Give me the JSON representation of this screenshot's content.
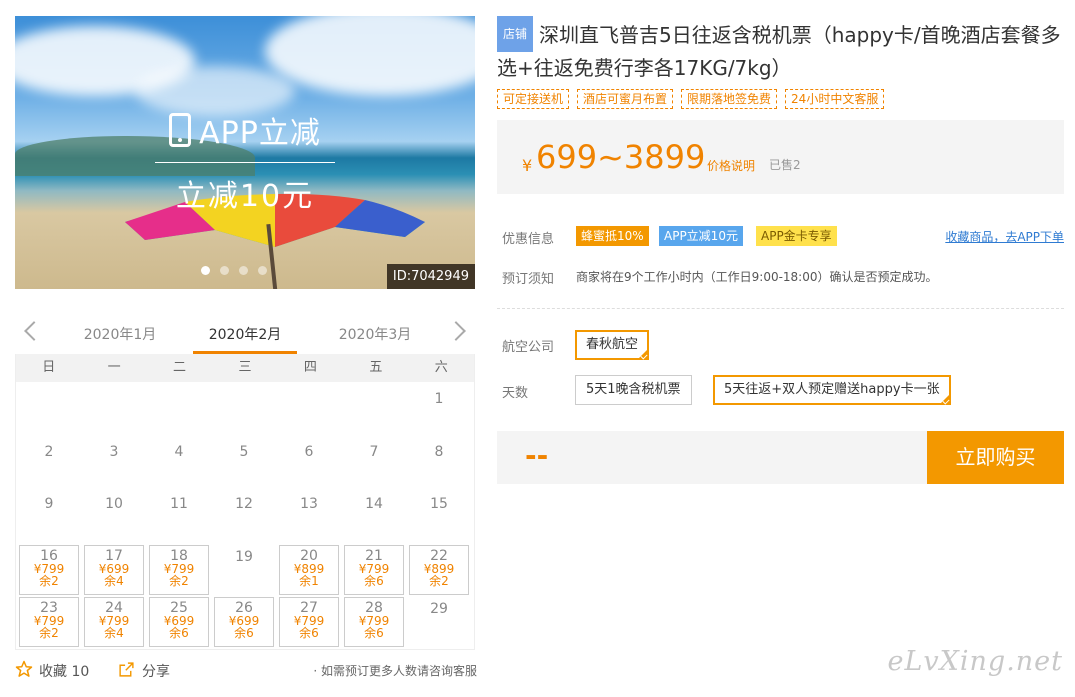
{
  "banner": {
    "app_text": "APP立减",
    "discount_text": "立减10元",
    "id_label": "ID:7042949"
  },
  "calendar": {
    "months": [
      "2020年1月",
      "2020年2月",
      "2020年3月"
    ],
    "weekdays": [
      "日",
      "一",
      "二",
      "三",
      "四",
      "五",
      "六"
    ],
    "days": [
      {
        "d": "1"
      },
      {
        "d": "2"
      },
      {
        "d": "3"
      },
      {
        "d": "4"
      },
      {
        "d": "5"
      },
      {
        "d": "6"
      },
      {
        "d": "7"
      },
      {
        "d": "8"
      },
      {
        "d": "9"
      },
      {
        "d": "10"
      },
      {
        "d": "11"
      },
      {
        "d": "12"
      },
      {
        "d": "13"
      },
      {
        "d": "14"
      },
      {
        "d": "15"
      },
      {
        "d": "16",
        "price": "¥799",
        "left": "余2"
      },
      {
        "d": "17",
        "price": "¥699",
        "left": "余4"
      },
      {
        "d": "18",
        "price": "¥799",
        "left": "余2"
      },
      {
        "d": "19"
      },
      {
        "d": "20",
        "price": "¥899",
        "left": "余1"
      },
      {
        "d": "21",
        "price": "¥799",
        "left": "余6"
      },
      {
        "d": "22",
        "price": "¥899",
        "left": "余2"
      },
      {
        "d": "23",
        "price": "¥799",
        "left": "余2"
      },
      {
        "d": "24",
        "price": "¥799",
        "left": "余4"
      },
      {
        "d": "25",
        "price": "¥699",
        "left": "余6"
      },
      {
        "d": "26",
        "price": "¥699",
        "left": "余6"
      },
      {
        "d": "27",
        "price": "¥799",
        "left": "余6"
      },
      {
        "d": "28",
        "price": "¥799",
        "left": "余6"
      },
      {
        "d": "29"
      }
    ]
  },
  "actions": {
    "favorite_label": "收藏 10",
    "share_label": "分享",
    "note": "· 如需预订更多人数请咨询客服"
  },
  "product": {
    "store_tag": "店铺",
    "title": "深圳直飞普吉5日往返含税机票（happy卡/首晚酒店套餐多选+往返免费行李各17KG/7kg）",
    "tags": [
      "可定接送机",
      "酒店可蜜月布置",
      "限期落地签免费",
      "24小时中文客服"
    ],
    "yen": "¥",
    "price_range": "699~3899",
    "price_note": "价格说明",
    "sold": "已售2"
  },
  "promo": {
    "label": "优惠信息",
    "items": [
      "蜂蜜抵10%",
      "APP立减10元",
      "APP金卡专享"
    ],
    "app_link": "收藏商品，去APP下单"
  },
  "booking": {
    "label": "预订须知",
    "text": "商家将在9个工作小时内（工作日9:00-18:00）确认是否预定成功。"
  },
  "airline": {
    "label": "航空公司",
    "selected": "春秋航空"
  },
  "days_option": {
    "label": "天数",
    "options": [
      "5天1晚含税机票",
      "5天往返+双人预定赠送happy卡一张"
    ]
  },
  "buy": {
    "price_placeholder": "--",
    "button": "立即购买"
  },
  "watermark": "eLvXing.net",
  "colors": {
    "accent": "#f39800",
    "price": "#f08300",
    "link": "#2f7bd2"
  }
}
